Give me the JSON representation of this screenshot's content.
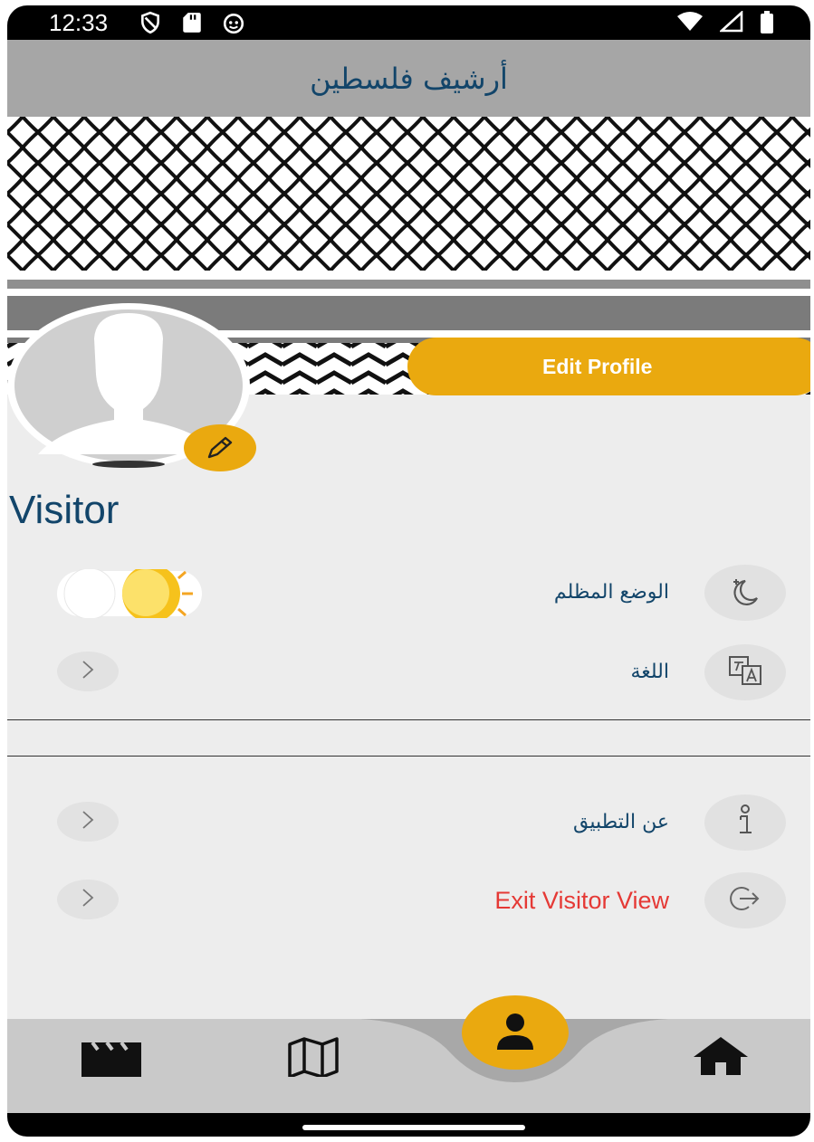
{
  "status": {
    "time": "12:33"
  },
  "appbar": {
    "title": "أرشيف فلسطين"
  },
  "profile": {
    "edit_label": "Edit Profile",
    "name": "Visitor"
  },
  "settings": [
    {
      "label": "الوضع المظلم",
      "icon": "moon-icon",
      "control": "theme-toggle"
    },
    {
      "label": "اللغة",
      "icon": "translate-icon",
      "control": "chevron"
    }
  ],
  "info": [
    {
      "label": "عن التطبيق",
      "icon": "info-icon",
      "control": "chevron"
    },
    {
      "label": "Exit Visitor View",
      "icon": "logout-icon",
      "control": "chevron",
      "color": "#e53935"
    }
  ],
  "nav": [
    {
      "name": "videos",
      "icon": "clapperboard-icon"
    },
    {
      "name": "map",
      "icon": "map-icon"
    },
    {
      "name": "profile",
      "icon": "person-icon",
      "active": true
    },
    {
      "name": "home",
      "icon": "home-icon"
    }
  ],
  "colors": {
    "accent": "#eaa90f",
    "title": "#12456a",
    "appbar": "#a6a6a6",
    "danger": "#e53935"
  }
}
